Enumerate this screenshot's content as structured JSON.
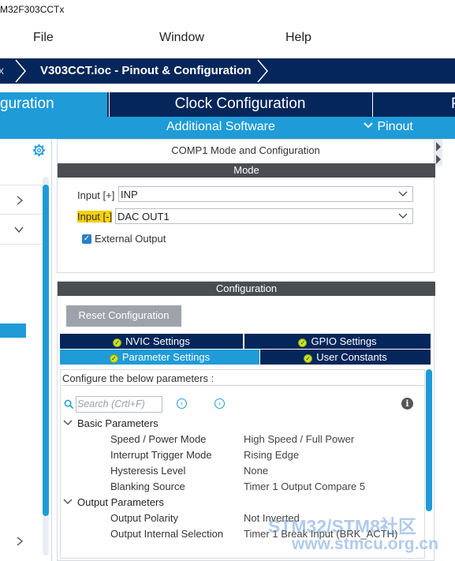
{
  "window": {
    "title": "M32F303CCTx"
  },
  "menu": {
    "file": "File",
    "window": "Window",
    "help": "Help"
  },
  "breadcrumb": {
    "close_glyph": "x",
    "title": "V303CCT.ioc - Pinout & Configuration"
  },
  "tabs": {
    "pinout_config": "guration",
    "clock_config": "Clock Configuration",
    "next": "P"
  },
  "subtabs": {
    "additional_software": "Additional Software",
    "pinout": "Pinout"
  },
  "mode_panel": {
    "heading": "COMP1 Mode and Configuration",
    "section": "Mode",
    "input_plus_label": "Input [+]",
    "input_plus_value": "INP",
    "input_minus_label": "Input [-]",
    "input_minus_value": "DAC OUT1",
    "external_output_label": "External Output",
    "external_output_checked": true
  },
  "config_panel": {
    "section": "Configuration",
    "reset_button": "Reset Configuration",
    "tabs": [
      "NVIC Settings",
      "GPIO Settings",
      "Parameter Settings",
      "User Constants"
    ],
    "active_tab": "Parameter Settings",
    "caption": "Configure the below parameters :",
    "search_placeholder": "Search (Crtl+F)",
    "groups": [
      {
        "name": "Basic Parameters",
        "params": [
          {
            "name": "Speed / Power Mode",
            "value": "High Speed / Full Power"
          },
          {
            "name": "Interrupt Trigger Mode",
            "value": "Rising Edge"
          },
          {
            "name": "Hysteresis Level",
            "value": "None"
          },
          {
            "name": "Blanking Source",
            "value": "Timer 1 Output Compare 5"
          }
        ]
      },
      {
        "name": "Output Parameters",
        "params": [
          {
            "name": "Output Polarity",
            "value": "Not Inverted"
          },
          {
            "name": "Output Internal Selection",
            "value": "Timer 1 Break Input (BRK_ACTH)"
          }
        ]
      }
    ]
  },
  "watermark": {
    "line1": "STM32/STM8社区",
    "line2": "www.stmcu.org.cn"
  },
  "colors": {
    "navy": "#05265a",
    "accent": "#1f9bd7",
    "highlight": "#f6d00f",
    "section_bar": "#4a4d52"
  }
}
